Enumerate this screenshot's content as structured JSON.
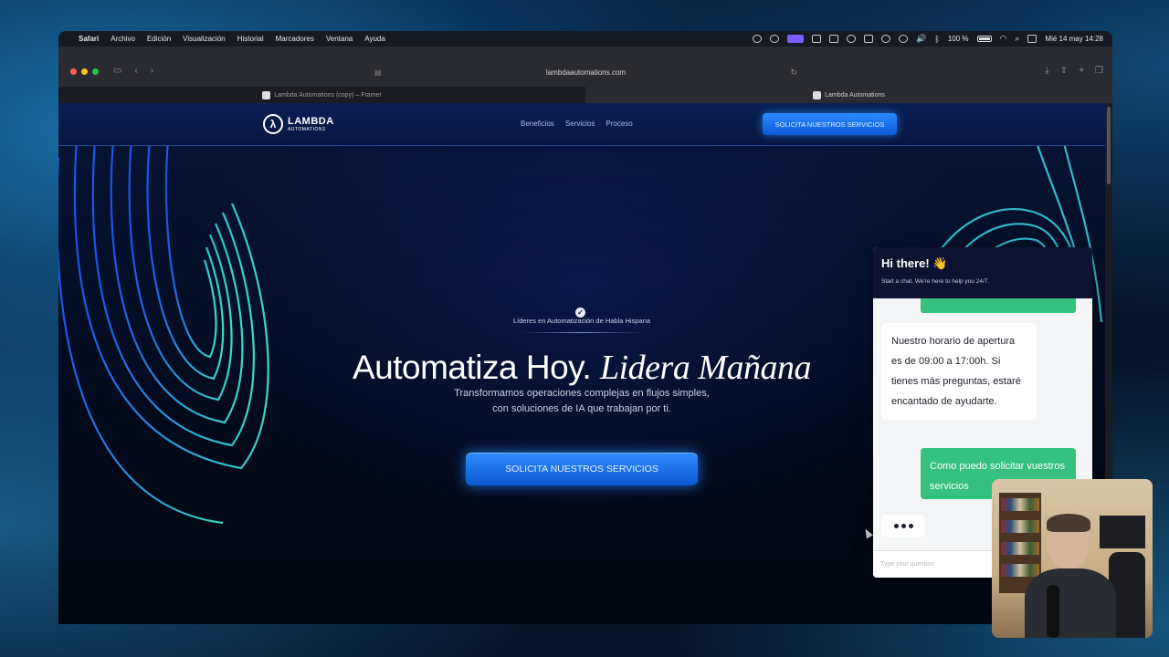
{
  "menubar": {
    "app_name": "Safari",
    "items": [
      "Archivo",
      "Edición",
      "Visualización",
      "Historial",
      "Marcadores",
      "Ventana",
      "Ayuda"
    ],
    "battery": "100 %",
    "datetime": "Mié 14 may 14:28"
  },
  "browser": {
    "url": "lambdaautomations.com",
    "tabs": [
      {
        "label": "Lambda Automations (copy) – Framer",
        "active": false
      },
      {
        "label": "Lambda Automations",
        "active": true
      }
    ]
  },
  "site": {
    "logo": {
      "line1": "LAMBDA",
      "line2": "AUTOMATIONS",
      "mark": "λ"
    },
    "nav_links": [
      "Beneficios",
      "Servicios",
      "Proceso"
    ],
    "nav_cta": "SOLICITA NUESTROS SERVICIOS",
    "badge": "Líderes en Automatización de Habla Hispana",
    "headline": {
      "part1": "Automatiza Hoy.",
      "part2": "Lidera Mañana"
    },
    "subheadline": "Transformamos operaciones complejas en flujos simples, con soluciones de IA que trabajan por ti.",
    "hero_cta": "SOLICITA NUESTROS SERVICIOS"
  },
  "chat": {
    "title": "Hi there! 👋",
    "subtitle": "Start a chat. We're here to help you 24/7.",
    "bot_message": "Nuestro horario de apertura es de 09:00 a 17:00h. Si tienes más preguntas, estaré encantado de ayudarte.",
    "user_message": "Como puedo solicitar vuestros servicios",
    "input_placeholder": "Type your question"
  },
  "colors": {
    "accent_blue": "#1e7bff",
    "chat_green": "#35c07d",
    "chat_header": "#0d1330"
  }
}
